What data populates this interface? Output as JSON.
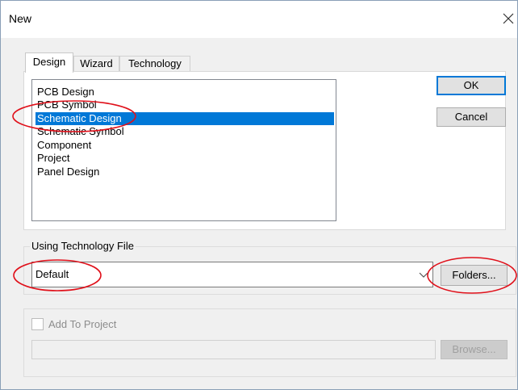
{
  "window": {
    "title": "New"
  },
  "tabs": [
    {
      "label": "Design",
      "active": true
    },
    {
      "label": "Wizard",
      "active": false
    },
    {
      "label": "Technology",
      "active": false
    }
  ],
  "list": {
    "items": [
      "PCB Design",
      "PCB Symbol",
      "Schematic Design",
      "Schematic Symbol",
      "Component",
      "Project",
      "Panel Design"
    ],
    "selected": "Schematic Design"
  },
  "buttons": {
    "ok": "OK",
    "cancel": "Cancel",
    "folders": "Folders...",
    "browse": "Browse..."
  },
  "tech": {
    "group_label": "Using Technology File",
    "value": "Default"
  },
  "project": {
    "checkbox_label": "Add To Project",
    "checked": false,
    "path": ""
  },
  "colors": {
    "selection": "#0078d7",
    "annotation": "#e0101a"
  }
}
